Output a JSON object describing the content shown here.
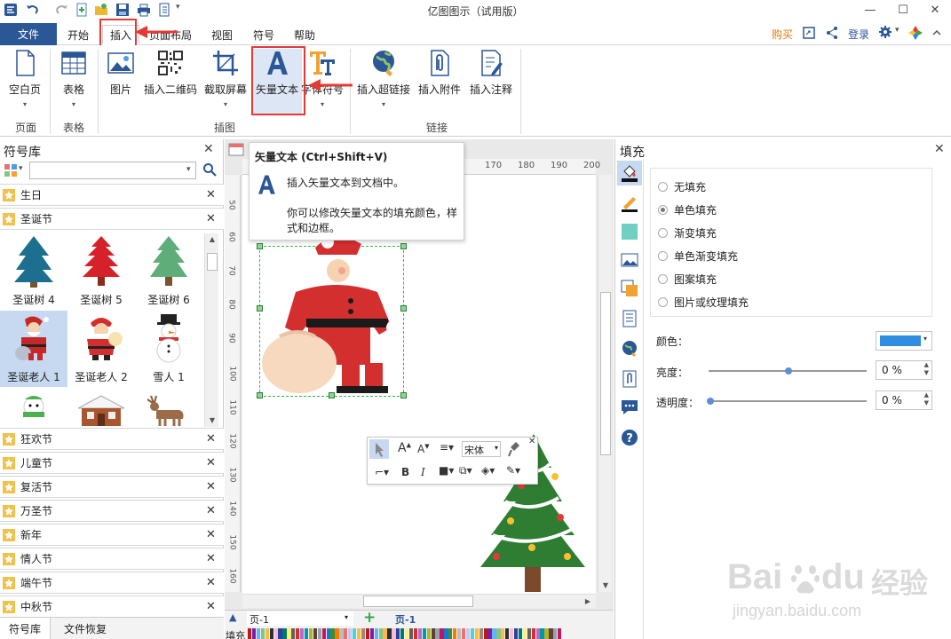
{
  "app": {
    "title": "亿图图示（试用版）"
  },
  "ribbon_tabs": [
    {
      "label": "开始"
    },
    {
      "label": "插入"
    },
    {
      "label": "页面布局"
    },
    {
      "label": "视图"
    },
    {
      "label": "符号"
    },
    {
      "label": "帮助"
    }
  ],
  "file_tab": {
    "label": "文件"
  },
  "top_right": {
    "buy": "购买",
    "login": "登录"
  },
  "ribbon": {
    "blank_page": "空白页",
    "table": "表格",
    "picture": "图片",
    "qr": "插入二维码",
    "screenshot": "截取屏幕",
    "vector_text": "矢量文本",
    "font_symbol": "字体符号",
    "hyperlink": "插入超链接",
    "attachment": "插入附件",
    "annotation": "插入注释",
    "group_page": "页面",
    "group_table": "表格",
    "group_illustration": "插图",
    "group_link": "链接"
  },
  "tooltip": {
    "title": "矢量文本 (Ctrl+Shift+V)",
    "line1": "插入矢量文本到文档中。",
    "line2": "你可以修改矢量文本的填充颜色，样",
    "line3": "式和边框。"
  },
  "symbol_library": {
    "title": "符号库",
    "categories_top": [
      {
        "label": "生日"
      },
      {
        "label": "圣诞节"
      }
    ],
    "items": [
      {
        "label": "圣诞树 4"
      },
      {
        "label": "圣诞树 5"
      },
      {
        "label": "圣诞树 6"
      },
      {
        "label": "圣诞老人 1"
      },
      {
        "label": "圣诞老人 2"
      },
      {
        "label": "雪人 1"
      }
    ],
    "categories_bottom": [
      {
        "label": "狂欢节"
      },
      {
        "label": "儿童节"
      },
      {
        "label": "复活节"
      },
      {
        "label": "万圣节"
      },
      {
        "label": "新年"
      },
      {
        "label": "情人节"
      },
      {
        "label": "端午节"
      },
      {
        "label": "中秋节"
      }
    ],
    "bottom_tabs": [
      {
        "label": "符号库"
      },
      {
        "label": "文件恢复"
      }
    ]
  },
  "ruler": {
    "top": [
      "170",
      "180",
      "190",
      "200"
    ],
    "left": [
      "50",
      "60",
      "70",
      "80",
      "90",
      "100",
      "110",
      "120",
      "130",
      "140",
      "150",
      "160"
    ]
  },
  "mini_toolbar": {
    "font": "宋体"
  },
  "fill_panel": {
    "title": "填充",
    "options": [
      {
        "label": "无填充",
        "selected": false
      },
      {
        "label": "单色填充",
        "selected": true
      },
      {
        "label": "渐变填充",
        "selected": false
      },
      {
        "label": "单色渐变填充",
        "selected": false
      },
      {
        "label": "图案填充",
        "selected": false
      },
      {
        "label": "图片或纹理填充",
        "selected": false
      }
    ],
    "color_label": "颜色：",
    "color_value": "#2f8ee0",
    "brightness_label": "亮度：",
    "brightness_value": "0 %",
    "transparency_label": "透明度：",
    "transparency_value": "0 %"
  },
  "bottom_bar": {
    "page_select": "页-1",
    "page_tab": "页-1",
    "fill_label": "填充"
  },
  "watermark": {
    "brand": "Bai",
    "brand2": "du",
    "cn": "经验",
    "url": "jingyan.baidu.com"
  }
}
